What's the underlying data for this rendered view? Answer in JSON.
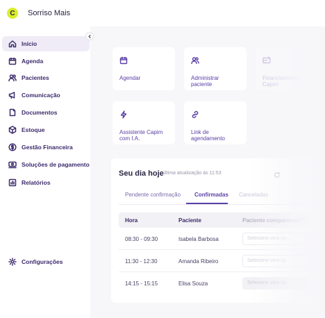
{
  "app": {
    "logo_letter": "C",
    "brand": "Sorriso Mais"
  },
  "sidebar": {
    "items": [
      {
        "label": "Início",
        "icon": "home-icon"
      },
      {
        "label": "Agenda",
        "icon": "calendar-icon"
      },
      {
        "label": "Pacientes",
        "icon": "users-icon"
      },
      {
        "label": "Comunicação",
        "icon": "megaphone-icon"
      },
      {
        "label": "Documentos",
        "icon": "document-icon"
      },
      {
        "label": "Estoque",
        "icon": "box-icon"
      },
      {
        "label": "Gestão Financeira",
        "icon": "dollar-icon"
      },
      {
        "label": "Soluções de pagamento",
        "icon": "payment-icon"
      },
      {
        "label": "Relatórios",
        "icon": "report-icon"
      }
    ],
    "settings": {
      "label": "Configurações",
      "icon": "gear-icon"
    }
  },
  "quick_actions": [
    {
      "label": "Agendar",
      "icon": "calendar-icon"
    },
    {
      "label": "Administrar paciente",
      "icon": "users-icon"
    },
    {
      "label": "Financiamento Capim",
      "icon": "finance-icon"
    },
    {
      "label": "Assistente Capim com I.A.",
      "icon": "lightning-icon"
    },
    {
      "label": "Link de agendamento",
      "icon": "link-icon"
    }
  ],
  "today": {
    "title": "Seu dia hoje",
    "updated": "· última atualização às 11:53",
    "tabs": [
      "Pendente confirmação",
      "Confirmadas",
      "Canceladas"
    ],
    "active_tab": "Confirmadas",
    "columns": [
      "Hora",
      "Paciente",
      "Paciente compareceu?"
    ],
    "select_placeholder": "Selecione uma op...",
    "rows": [
      {
        "time": "08:30 - 09:30",
        "patient": "Isabela Barbosa"
      },
      {
        "time": "11:30 - 12:30",
        "patient": "Amanda Ribeiro"
      },
      {
        "time": "14:15 - 15:15",
        "patient": "Elisa Souza"
      }
    ]
  },
  "colors": {
    "accent": "#5a3ea5",
    "logo": "#d8ee2a",
    "active_bg": "#efecf7"
  }
}
